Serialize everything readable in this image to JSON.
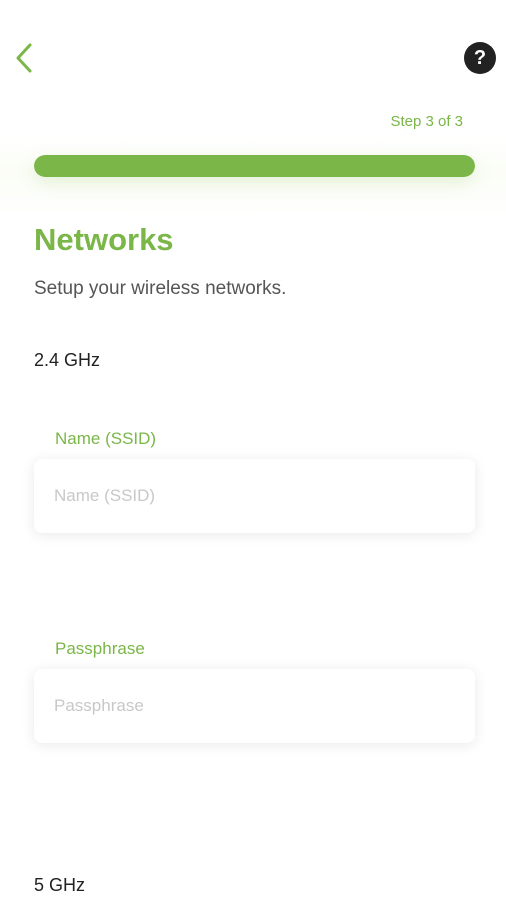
{
  "header": {
    "back_icon": "chevron-left-icon",
    "help_icon": "question-mark-icon",
    "help_glyph": "?"
  },
  "progress": {
    "step_label": "Step 3 of 3",
    "fraction": 1.0,
    "color": "#7ab648"
  },
  "page": {
    "title": "Networks",
    "subtitle": "Setup your wireless networks."
  },
  "band_24": {
    "heading": "2.4 GHz",
    "name_field": {
      "label": "Name (SSID)",
      "placeholder": "Name (SSID)",
      "value": ""
    },
    "passphrase_field": {
      "label": "Passphrase",
      "placeholder": "Passphrase",
      "value": ""
    }
  },
  "band_5": {
    "heading": "5 GHz"
  },
  "colors": {
    "accent": "#7ab648",
    "text": "#222222",
    "muted": "#555555",
    "placeholder": "#c8c8c8"
  }
}
